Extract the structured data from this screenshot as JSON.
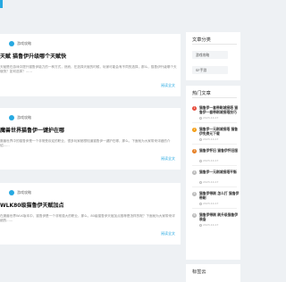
{
  "colors": {
    "accent": "#27a9e1",
    "rank1": "#e74c3c",
    "rank2": "#f39c12",
    "rank3": "#e67e22",
    "rankOther": "#bbbbbb"
  },
  "articles": [
    {
      "category": "游戏攻略",
      "title": "天赋 猫鲁伊升级哪个天赋快",
      "excerpt": "天赋是在游戏中提升猫鲁伊能力的一种方式，然而，在选择天赋的时候，玩家可能会有不同的选择，那么，猫鲁伊升级哪个天赋快？如何选择？……",
      "more": "阅读全文"
    },
    {
      "category": "游戏攻略",
      "title": "魔兽世界猫鲁伊一键护在哪",
      "excerpt": "魔兽世界中的猫鲁伊是一个非常受欢迎的职业，很多玩家都想知道猫鲁伊一键护在哪，那么，下面就为大家带来详细的介绍……",
      "more": "阅读全文"
    },
    {
      "category": "游戏攻略",
      "title": "WLK80级猫鲁伊天赋加点",
      "excerpt": "在魔兽世界WLK版本中，猫鲁伊是一个非常强大的职业，那么，80级猫鲁伊天赋加点推荐是怎样的呢？下面就为大家带来详细的……",
      "more": "阅读全文"
    }
  ],
  "sidebar": {
    "categories": {
      "title": "文章分类",
      "items": [
        "游戏攻略",
        "SF手游"
      ]
    },
    "hot": {
      "title": "热门文章",
      "items": [
        {
          "rank": "1",
          "title": "猫鲁伊一套带刷城接塔 猫鲁伊一套带刷城接塔技巧",
          "date": "2023-10-17"
        },
        {
          "rank": "2",
          "title": "猫鲁伊一元刷城接塔 猫鲁伊免费元下载",
          "date": "2023-10-17"
        },
        {
          "rank": "3",
          "title": "猫鲁伊怀旧 猫鲁伊怀旧服",
          "date": "2023-10-17"
        },
        {
          "rank": "4",
          "title": "猫鲁伊一元刷城接塔平衡",
          "date": "2023-10-17"
        },
        {
          "rank": "5",
          "title": "猫鲁伊带刷 怎么打 猫鲁伊带刷",
          "date": "2023-10-17"
        },
        {
          "rank": "6",
          "title": "猫鲁伊带刷 刷升级猫鲁伊装备",
          "date": "2023-10-17"
        }
      ]
    },
    "tags": {
      "title": "标签云"
    }
  }
}
